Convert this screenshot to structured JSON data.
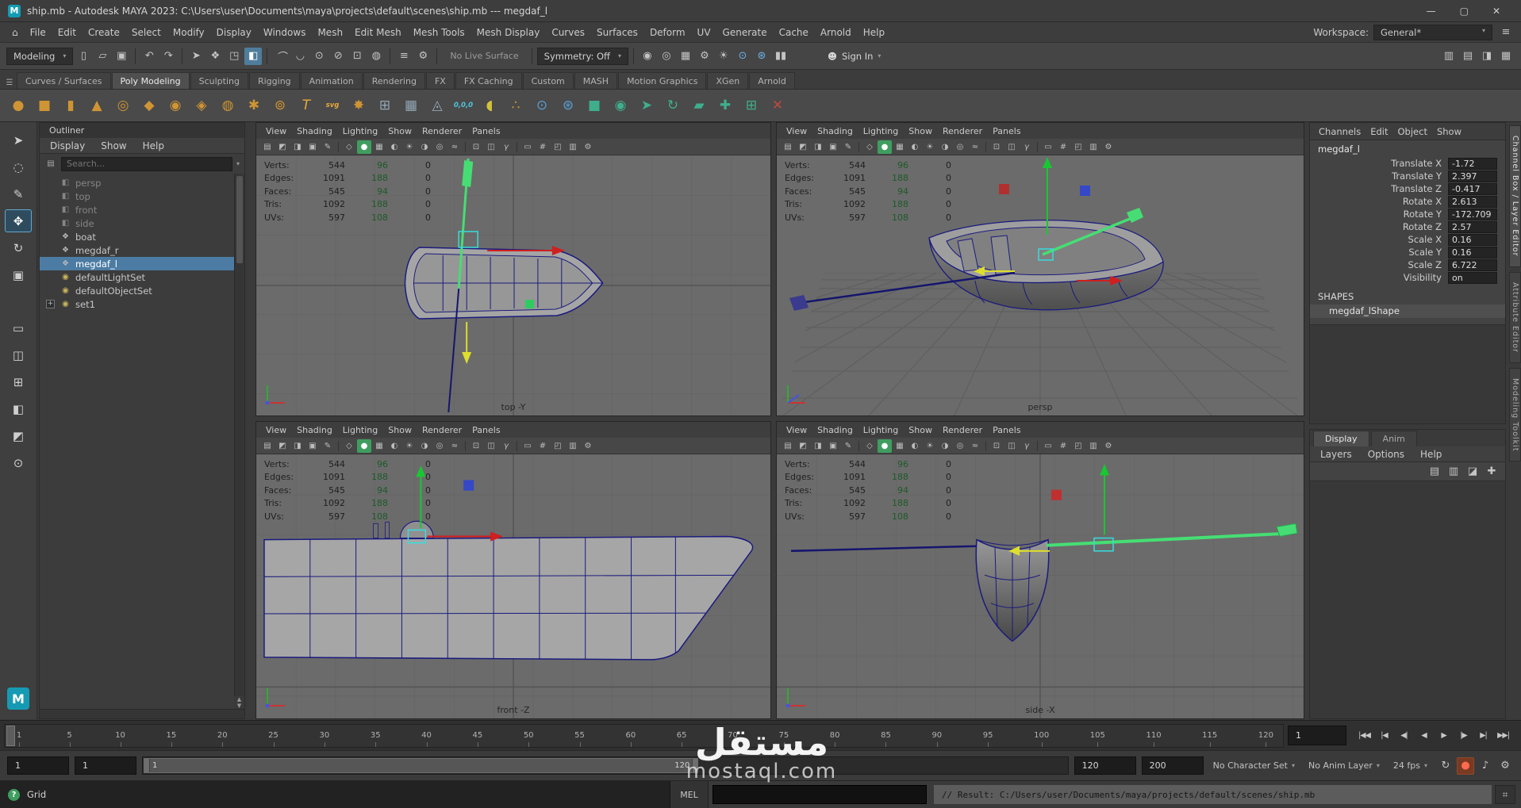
{
  "window": {
    "title": "ship.mb - Autodesk MAYA 2023: C:\\Users\\user\\Documents\\maya\\projects\\default\\scenes\\ship.mb --- megdaf_l",
    "minimize": "—",
    "maximize": "▢",
    "close": "✕",
    "app_badge": "M"
  },
  "menubar": {
    "items": [
      "File",
      "Edit",
      "Create",
      "Select",
      "Modify",
      "Display",
      "Windows",
      "Mesh",
      "Edit Mesh",
      "Mesh Tools",
      "Mesh Display",
      "Curves",
      "Surfaces",
      "Deform",
      "UV",
      "Generate",
      "Cache",
      "Arnold",
      "Help"
    ],
    "home_icon": "⌂",
    "workspace_label": "Workspace:",
    "workspace_value": "General*",
    "workspace_caret": "▾"
  },
  "statusline": {
    "mode": "Modeling",
    "mode_caret": "▾",
    "left_icons": [
      {
        "g": "▯",
        "n": "new-scene-icon"
      },
      {
        "g": "▱",
        "n": "open-scene-icon"
      },
      {
        "g": "▣",
        "n": "save-scene-icon"
      },
      {
        "cls": "sep",
        "n": "separator"
      },
      {
        "g": "↶",
        "n": "undo-icon"
      },
      {
        "g": "↷",
        "n": "redo-icon"
      },
      {
        "cls": "sep",
        "n": "separator"
      },
      {
        "g": "➤",
        "n": "select-tool-icon"
      },
      {
        "g": "❖",
        "n": "select-hierarchy-icon"
      },
      {
        "g": "◳",
        "n": "select-object-mode-icon"
      },
      {
        "g": "◧",
        "n": "select-component-mode-icon",
        "cls": "active"
      },
      {
        "cls": "sep",
        "n": "separator"
      },
      {
        "g": "⌒",
        "n": "snap-to-grid-icon"
      },
      {
        "g": "◡",
        "n": "snap-to-curve-icon"
      },
      {
        "g": "⊙",
        "n": "snap-to-point-icon"
      },
      {
        "g": "⊘",
        "n": "snap-to-projected-icon"
      },
      {
        "g": "⊡",
        "n": "snap-to-view-plane-icon"
      },
      {
        "g": "◍",
        "n": "make-live-icon"
      },
      {
        "cls": "sep",
        "n": "separator"
      },
      {
        "g": "≡",
        "n": "input-connections-icon"
      },
      {
        "g": "⚙",
        "n": "construction-history-icon"
      },
      {
        "cls": "sep",
        "n": "separator"
      }
    ],
    "live_surface": "No Live Surface",
    "symmetry": "Symmetry: Off",
    "symmetry_caret": "▾",
    "render_icons": [
      {
        "g": "◉",
        "n": "render-frame-icon"
      },
      {
        "g": "◎",
        "n": "ipr-render-icon"
      },
      {
        "g": "▦",
        "n": "render-sequence-icon"
      },
      {
        "g": "⚙",
        "n": "render-settings-icon"
      },
      {
        "g": "☀",
        "n": "light-editor-icon"
      },
      {
        "g": "⊙",
        "n": "hypershade-icon",
        "cls": "blue"
      },
      {
        "g": "⊛",
        "n": "paint-effects-icon",
        "cls": "blue"
      },
      {
        "g": "▮▮",
        "n": "pause-viewport-icon"
      }
    ],
    "signin_icon": "☻",
    "signin": "Sign In",
    "signin_caret": "▾",
    "right_icons": [
      {
        "g": "▥",
        "n": "toggle-modeling-toolkit-icon"
      },
      {
        "g": "▤",
        "n": "toggle-attribute-editor-icon"
      },
      {
        "g": "◨",
        "n": "toggle-tool-settings-icon"
      },
      {
        "g": "▦",
        "n": "toggle-channel-box-icon"
      }
    ]
  },
  "shelf": {
    "menu_icon": "☰",
    "tabs": [
      {
        "label": "Curves / Surfaces",
        "n": "shelf-tab-curves-surfaces"
      },
      {
        "label": "Poly Modeling",
        "cls": "active",
        "n": "shelf-tab-poly-modeling"
      },
      {
        "label": "Sculpting",
        "n": "shelf-tab-sculpting"
      },
      {
        "label": "Rigging",
        "n": "shelf-tab-rigging"
      },
      {
        "label": "Animation",
        "n": "shelf-tab-animation"
      },
      {
        "label": "Rendering",
        "n": "shelf-tab-rendering"
      },
      {
        "label": "FX",
        "n": "shelf-tab-fx"
      },
      {
        "label": "FX Caching",
        "n": "shelf-tab-fx-caching"
      },
      {
        "label": "Custom",
        "n": "shelf-tab-custom"
      },
      {
        "label": "MASH",
        "n": "shelf-tab-mash"
      },
      {
        "label": "Motion Graphics",
        "n": "shelf-tab-motion-graphics"
      },
      {
        "label": "XGen",
        "n": "shelf-tab-xgen"
      },
      {
        "label": "Arnold",
        "n": "shelf-tab-arnold"
      }
    ],
    "icons": [
      {
        "g": "●",
        "c": "#cf9434",
        "n": "poly-sphere-icon"
      },
      {
        "g": "■",
        "c": "#cf9434",
        "n": "poly-cube-icon"
      },
      {
        "g": "▮",
        "c": "#cf9434",
        "n": "poly-cylinder-icon"
      },
      {
        "g": "▲",
        "c": "#cf9434",
        "n": "poly-cone-icon"
      },
      {
        "g": "◎",
        "c": "#cf9434",
        "n": "poly-torus-icon"
      },
      {
        "g": "◆",
        "c": "#cf9434",
        "n": "poly-plane-icon"
      },
      {
        "g": "◉",
        "c": "#cf9434",
        "n": "poly-disc-icon"
      },
      {
        "g": "◈",
        "c": "#cf9434",
        "n": "platonic-solid-icon"
      },
      {
        "g": "◍",
        "c": "#cf9434",
        "n": "poly-pipe-icon"
      },
      {
        "g": "✱",
        "c": "#cf9434",
        "n": "poly-helix-icon"
      },
      {
        "g": "⊚",
        "c": "#cf9434",
        "n": "poly-gear-icon"
      },
      {
        "g": "T",
        "c": "#e8a93c",
        "n": "poly-text-icon"
      },
      {
        "g": "svg",
        "c": "#e8a93c",
        "n": "svg-tool-icon",
        "cls": "txt"
      },
      {
        "g": "✸",
        "c": "#cf9434",
        "n": "super-shape-icon"
      },
      {
        "g": "⊞",
        "c": "#93a7b5",
        "n": "subdiv-grid-icon"
      },
      {
        "g": "▦",
        "c": "#93a7b5",
        "n": "remesh-icon"
      },
      {
        "g": "◬",
        "c": "#93a7b5",
        "n": "triangulate-icon"
      },
      {
        "g": "0,0,0",
        "c": "#4fc3d8",
        "n": "coordinates-icon",
        "cls": "txt"
      },
      {
        "g": "◖",
        "c": "#d2c23c",
        "n": "dome-icon"
      },
      {
        "g": "∴",
        "c": "#cf9434",
        "n": "scatter-icon"
      },
      {
        "g": "⊙",
        "c": "#5a9fd4",
        "n": "snap-together-icon"
      },
      {
        "g": "⊛",
        "c": "#5a9fd4",
        "n": "sculpt-effects-icon"
      },
      {
        "g": "■",
        "c": "#3fae8c",
        "n": "quad-draw-icon"
      },
      {
        "g": "◉",
        "c": "#3fae8c",
        "n": "append-to-poly-icon"
      },
      {
        "g": "➤",
        "c": "#3fae8c",
        "n": "slide-edge-icon"
      },
      {
        "g": "↻",
        "c": "#3fae8c",
        "n": "spin-edge-icon"
      },
      {
        "g": "▰",
        "c": "#3fae8c",
        "n": "bridge-icon"
      },
      {
        "g": "✚",
        "c": "#3fae8c",
        "n": "multi-cut-icon"
      },
      {
        "g": "⊞",
        "c": "#3fae8c",
        "n": "connect-icon"
      },
      {
        "g": "✕",
        "c": "#bf4a3f",
        "n": "delete-edge-icon"
      }
    ]
  },
  "toolbox": {
    "tools": [
      {
        "g": "➤",
        "n": "select-tool"
      },
      {
        "g": "◌",
        "n": "lasso-select-tool"
      },
      {
        "g": "✎",
        "n": "paint-select-tool"
      },
      {
        "g": "✥",
        "n": "move-tool",
        "cls": "active"
      },
      {
        "g": "↻",
        "n": "rotate-tool"
      },
      {
        "g": "▣",
        "n": "scale-tool"
      }
    ],
    "layouts": [
      {
        "g": "▭",
        "n": "single-pane-layout-button"
      },
      {
        "g": "◫",
        "n": "two-pane-layout-button"
      },
      {
        "g": "⊞",
        "n": "four-pane-layout-button"
      },
      {
        "g": "◧",
        "n": "outliner-persp-layout-button"
      },
      {
        "g": "◩",
        "n": "split-layout-button"
      },
      {
        "g": "⊙",
        "n": "magnifier-icon"
      }
    ],
    "maya_badge": "M"
  },
  "outliner": {
    "title": "Outliner",
    "menus": [
      "Display",
      "Show",
      "Help"
    ],
    "filter_icon": "▤",
    "search_placeholder": "Search...",
    "search_caret": "▾",
    "items": [
      {
        "label": "persp",
        "g": "◧",
        "cls": "dim",
        "n": "outliner-item-persp"
      },
      {
        "label": "top",
        "g": "◧",
        "cls": "dim",
        "n": "outliner-item-top"
      },
      {
        "label": "front",
        "g": "◧",
        "cls": "dim",
        "n": "outliner-item-front"
      },
      {
        "label": "side",
        "g": "◧",
        "cls": "dim",
        "n": "outliner-item-side"
      },
      {
        "label": "boat",
        "g": "❖",
        "n": "outliner-item-boat"
      },
      {
        "label": "megdaf_r",
        "g": "❖",
        "n": "outliner-item-megdaf-r"
      },
      {
        "label": "megdaf_l",
        "g": "❖",
        "cls": "selected",
        "n": "outliner-item-megdaf-l"
      },
      {
        "label": "defaultLightSet",
        "g": "◉",
        "ic": "#c9b25a",
        "n": "outliner-item-defaultlightset"
      },
      {
        "label": "defaultObjectSet",
        "g": "◉",
        "ic": "#c9b25a",
        "n": "outliner-item-defaultobjectset"
      },
      {
        "label": "set1",
        "g": "◉",
        "ic": "#c9b25a",
        "exp": "+",
        "n": "outliner-item-set1"
      }
    ]
  },
  "viewport_menus": [
    "View",
    "Shading",
    "Lighting",
    "Show",
    "Renderer",
    "Panels"
  ],
  "viewport_icons": [
    {
      "g": "▤",
      "n": "select-camera-icon"
    },
    {
      "g": "◩",
      "n": "lock-camera-icon"
    },
    {
      "g": "◨",
      "n": "camera-attributes-icon"
    },
    {
      "g": "▣",
      "n": "bookmarks-icon"
    },
    {
      "g": "✎",
      "n": "grease-pencil-icon"
    },
    {
      "cls": "sep",
      "n": "separator"
    },
    {
      "g": "◇",
      "n": "wireframe-icon"
    },
    {
      "g": "●",
      "n": "smooth-shade-icon",
      "cls": "active"
    },
    {
      "g": "▦",
      "n": "textured-icon"
    },
    {
      "g": "◐",
      "n": "default-material-icon"
    },
    {
      "g": "☀",
      "n": "lighting-icon"
    },
    {
      "g": "◑",
      "n": "shadows-icon"
    },
    {
      "g": "◎",
      "n": "ambient-occlusion-icon"
    },
    {
      "g": "≈",
      "n": "motion-blur-icon"
    },
    {
      "cls": "sep",
      "n": "separator"
    },
    {
      "g": "⊡",
      "n": "isolate-select-icon"
    },
    {
      "g": "◫",
      "n": "xray-icon"
    },
    {
      "g": "γ",
      "n": "gamma-icon"
    },
    {
      "cls": "sep",
      "n": "separator"
    },
    {
      "g": "▭",
      "n": "film-gate-icon"
    },
    {
      "g": "#",
      "n": "resolution-gate-icon"
    },
    {
      "g": "◰",
      "n": "gate-mask-icon"
    },
    {
      "g": "▥",
      "n": "hud-toggle-icon"
    },
    {
      "g": "⚙",
      "n": "viewport-settings-icon"
    }
  ],
  "hud": {
    "rows": [
      {
        "label": "Verts:",
        "v1": "544",
        "v2": "96",
        "v3": "0"
      },
      {
        "label": "Edges:",
        "v1": "1091",
        "v2": "188",
        "v3": "0"
      },
      {
        "label": "Faces:",
        "v1": "545",
        "v2": "94",
        "v3": "0"
      },
      {
        "label": "Tris:",
        "v1": "1092",
        "v2": "188",
        "v3": "0"
      },
      {
        "label": "UVs:",
        "v1": "597",
        "v2": "108",
        "v3": "0"
      }
    ]
  },
  "viewports": {
    "top_label": "top -Y",
    "persp_label": "persp",
    "front_label": "front -Z",
    "side_label": "side -X"
  },
  "channelbox": {
    "menus": [
      "Channels",
      "Edit",
      "Object",
      "Show"
    ],
    "object_name": "megdaf_l",
    "attributes": [
      {
        "label": "Translate X",
        "value": "-1.72",
        "n": "channel-translate-x"
      },
      {
        "label": "Translate Y",
        "value": "2.397",
        "n": "channel-translate-y"
      },
      {
        "label": "Translate Z",
        "value": "-0.417",
        "n": "channel-translate-z"
      },
      {
        "label": "Rotate X",
        "value": "2.613",
        "n": "channel-rotate-x"
      },
      {
        "label": "Rotate Y",
        "value": "-172.709",
        "n": "channel-rotate-y"
      },
      {
        "label": "Rotate Z",
        "value": "2.57",
        "n": "channel-rotate-z"
      },
      {
        "label": "Scale X",
        "value": "0.16",
        "n": "channel-scale-x"
      },
      {
        "label": "Scale Y",
        "value": "0.16",
        "n": "channel-scale-y"
      },
      {
        "label": "Scale Z",
        "value": "6.722",
        "n": "channel-scale-z"
      },
      {
        "label": "Visibility",
        "value": "on",
        "n": "channel-visibility"
      }
    ],
    "shapes_header": "SHAPES",
    "shape_name": "megdaf_lShape"
  },
  "right_tabs": [
    {
      "label": "Channel Box / Layer Editor",
      "cls": "active",
      "n": "sidebar-tab-channel-box"
    },
    {
      "label": "Attribute Editor",
      "n": "sidebar-tab-attribute-editor"
    },
    {
      "label": "Modeling Toolkit",
      "n": "sidebar-tab-modeling-toolkit"
    }
  ],
  "layer_editor": {
    "tabs": [
      {
        "label": "Display",
        "cls": "active",
        "n": "layer-tab-display"
      },
      {
        "label": "Anim",
        "n": "layer-tab-anim"
      }
    ],
    "menus": [
      "Layers",
      "Options",
      "Help"
    ],
    "icons": [
      {
        "g": "▤",
        "n": "new-empty-layer-icon"
      },
      {
        "g": "▥",
        "n": "new-layer-from-selected-icon"
      },
      {
        "g": "◪",
        "n": "layer-options-icon"
      },
      {
        "g": "✚",
        "n": "add-layer-icon"
      }
    ]
  },
  "timeline": {
    "ticks": [
      "1",
      "5",
      "10",
      "15",
      "20",
      "25",
      "30",
      "35",
      "40",
      "45",
      "50",
      "55",
      "60",
      "65",
      "70",
      "75",
      "80",
      "85",
      "90",
      "95",
      "100",
      "105",
      "110",
      "115",
      "120"
    ],
    "current_frame": "1"
  },
  "transport": [
    {
      "g": "|◀◀",
      "n": "go-to-start-button"
    },
    {
      "g": "|◀",
      "n": "step-back-frame-button"
    },
    {
      "g": "◀|",
      "n": "step-back-key-button"
    },
    {
      "g": "◀",
      "n": "play-backwards-button"
    },
    {
      "g": "▶",
      "n": "play-forwards-button"
    },
    {
      "g": "|▶",
      "n": "step-forward-key-button"
    },
    {
      "g": "▶|",
      "n": "step-forward-frame-button"
    },
    {
      "g": "▶▶|",
      "n": "go-to-end-button"
    }
  ],
  "range": {
    "anim_start": "1",
    "playback_start": "1",
    "bar_start_label": "1",
    "bar_end_label": "120",
    "playback_end": "120",
    "anim_end": "200",
    "character_set": "No Character Set",
    "anim_layer": "No Anim Layer",
    "fps": "24 fps",
    "caret": "▾",
    "icons": [
      {
        "g": "↻",
        "n": "playback-loop-icon"
      },
      {
        "g": "●",
        "n": "auto-key-icon",
        "cls": "autokey"
      },
      {
        "g": "♪",
        "n": "sound-icon"
      },
      {
        "g": "⚙",
        "n": "animation-preferences-icon"
      }
    ]
  },
  "commandline": {
    "label": "MEL",
    "result": "// Result: C:/Users/user/Documents/maya/projects/default/scenes/ship.mb",
    "script_editor_icon": "⌗"
  },
  "helpline": {
    "icon": "?",
    "text": "Grid"
  },
  "watermark": {
    "title": "مستقل",
    "subtitle": "mostaql.com"
  }
}
